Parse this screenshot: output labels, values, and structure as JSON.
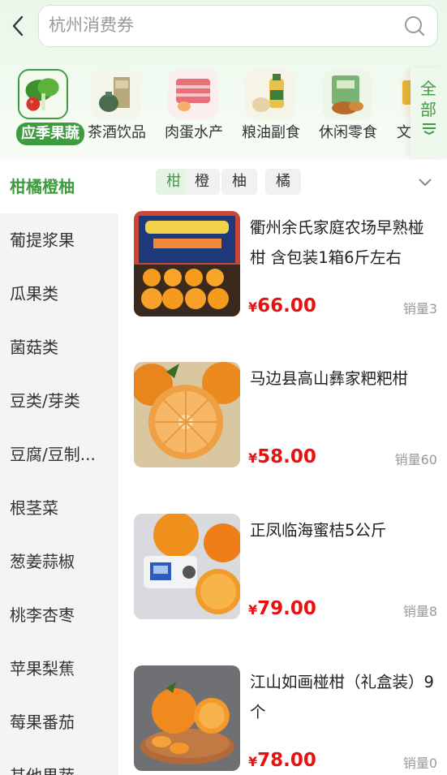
{
  "header": {
    "search_placeholder": "杭州消费券"
  },
  "categories": [
    {
      "label": "应季果蔬",
      "active": true
    },
    {
      "label": "茶酒饮品",
      "active": false
    },
    {
      "label": "肉蛋水产",
      "active": false
    },
    {
      "label": "粮油副食",
      "active": false
    },
    {
      "label": "休闲零食",
      "active": false
    },
    {
      "label": "文",
      "active": false
    }
  ],
  "all_button": {
    "line1": "全",
    "line2": "部"
  },
  "sidebar": {
    "items": [
      {
        "label": "柑橘橙柚",
        "active": true
      },
      {
        "label": "葡提浆果"
      },
      {
        "label": "瓜果类"
      },
      {
        "label": "菌菇类"
      },
      {
        "label": "豆类/芽类"
      },
      {
        "label": "豆腐/豆制..."
      },
      {
        "label": "根茎菜"
      },
      {
        "label": "葱姜蒜椒"
      },
      {
        "label": "桃李杏枣"
      },
      {
        "label": "苹果梨蕉"
      },
      {
        "label": "莓果番茄"
      },
      {
        "label": "其他果蔬"
      }
    ]
  },
  "filters": [
    {
      "label": "柑",
      "active": true
    },
    {
      "label": "橙"
    },
    {
      "label": "柚"
    },
    {
      "label": "橘"
    }
  ],
  "products": [
    {
      "title": "衢州余氏家庭农场早熟椪柑 含包装1箱6斤左右",
      "currency": "¥",
      "price": "66.00",
      "sales": "销量3"
    },
    {
      "title": "马边县高山彝家粑粑柑",
      "currency": "¥",
      "price": "58.00",
      "sales": "销量60"
    },
    {
      "title": "正凤临海蜜桔5公斤",
      "currency": "¥",
      "price": "79.00",
      "sales": "销量8"
    },
    {
      "title": "江山如画椪柑（礼盒装）9个",
      "currency": "¥",
      "price": "78.00",
      "sales": "销量0"
    }
  ],
  "colors": {
    "accent": "#3e9b40",
    "price": "#e8110f",
    "muted": "#9a9a9a"
  }
}
